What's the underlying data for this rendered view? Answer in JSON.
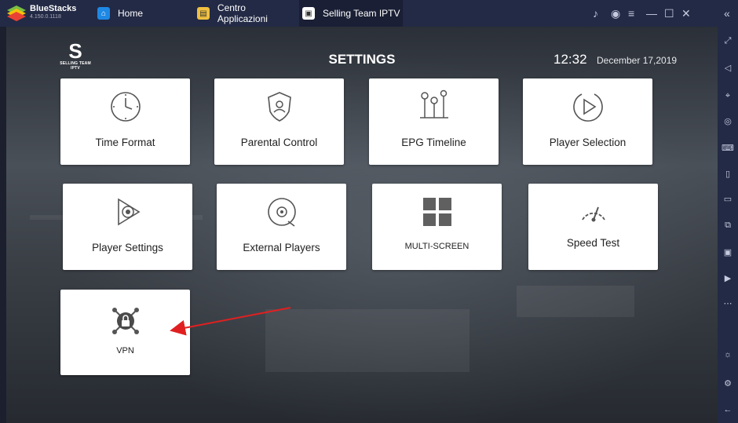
{
  "window": {
    "brand": "BlueStacks",
    "version": "4.150.0.1118",
    "tabs": [
      {
        "label": "Home",
        "icon": "home-icon"
      },
      {
        "label": "Centro Applicazioni",
        "icon": "app-center-icon"
      },
      {
        "label": "Selling Team IPTV",
        "icon": "app-icon"
      }
    ]
  },
  "header": {
    "logo_text": "SELLING TEAM IPTV",
    "title": "SETTINGS",
    "time": "12:32",
    "date": "December 17,2019"
  },
  "tiles": [
    {
      "label": "Time Format",
      "icon": "clock-icon"
    },
    {
      "label": "Parental Control",
      "icon": "shield-user-icon"
    },
    {
      "label": "EPG Timeline",
      "icon": "timeline-icon"
    },
    {
      "label": "Player Selection",
      "icon": "play-circle-icon"
    },
    {
      "label": "Player Settings",
      "icon": "player-settings-icon"
    },
    {
      "label": "External Players",
      "icon": "disc-icon"
    },
    {
      "label": "MULTI-SCREEN",
      "icon": "grid-icon"
    },
    {
      "label": "Speed Test",
      "icon": "speedometer-icon"
    },
    {
      "label": "VPN",
      "icon": "vpn-lock-icon"
    }
  ],
  "colors": {
    "topbar": "#232a45",
    "tile": "#ffffff",
    "arrow": "#e02020"
  }
}
